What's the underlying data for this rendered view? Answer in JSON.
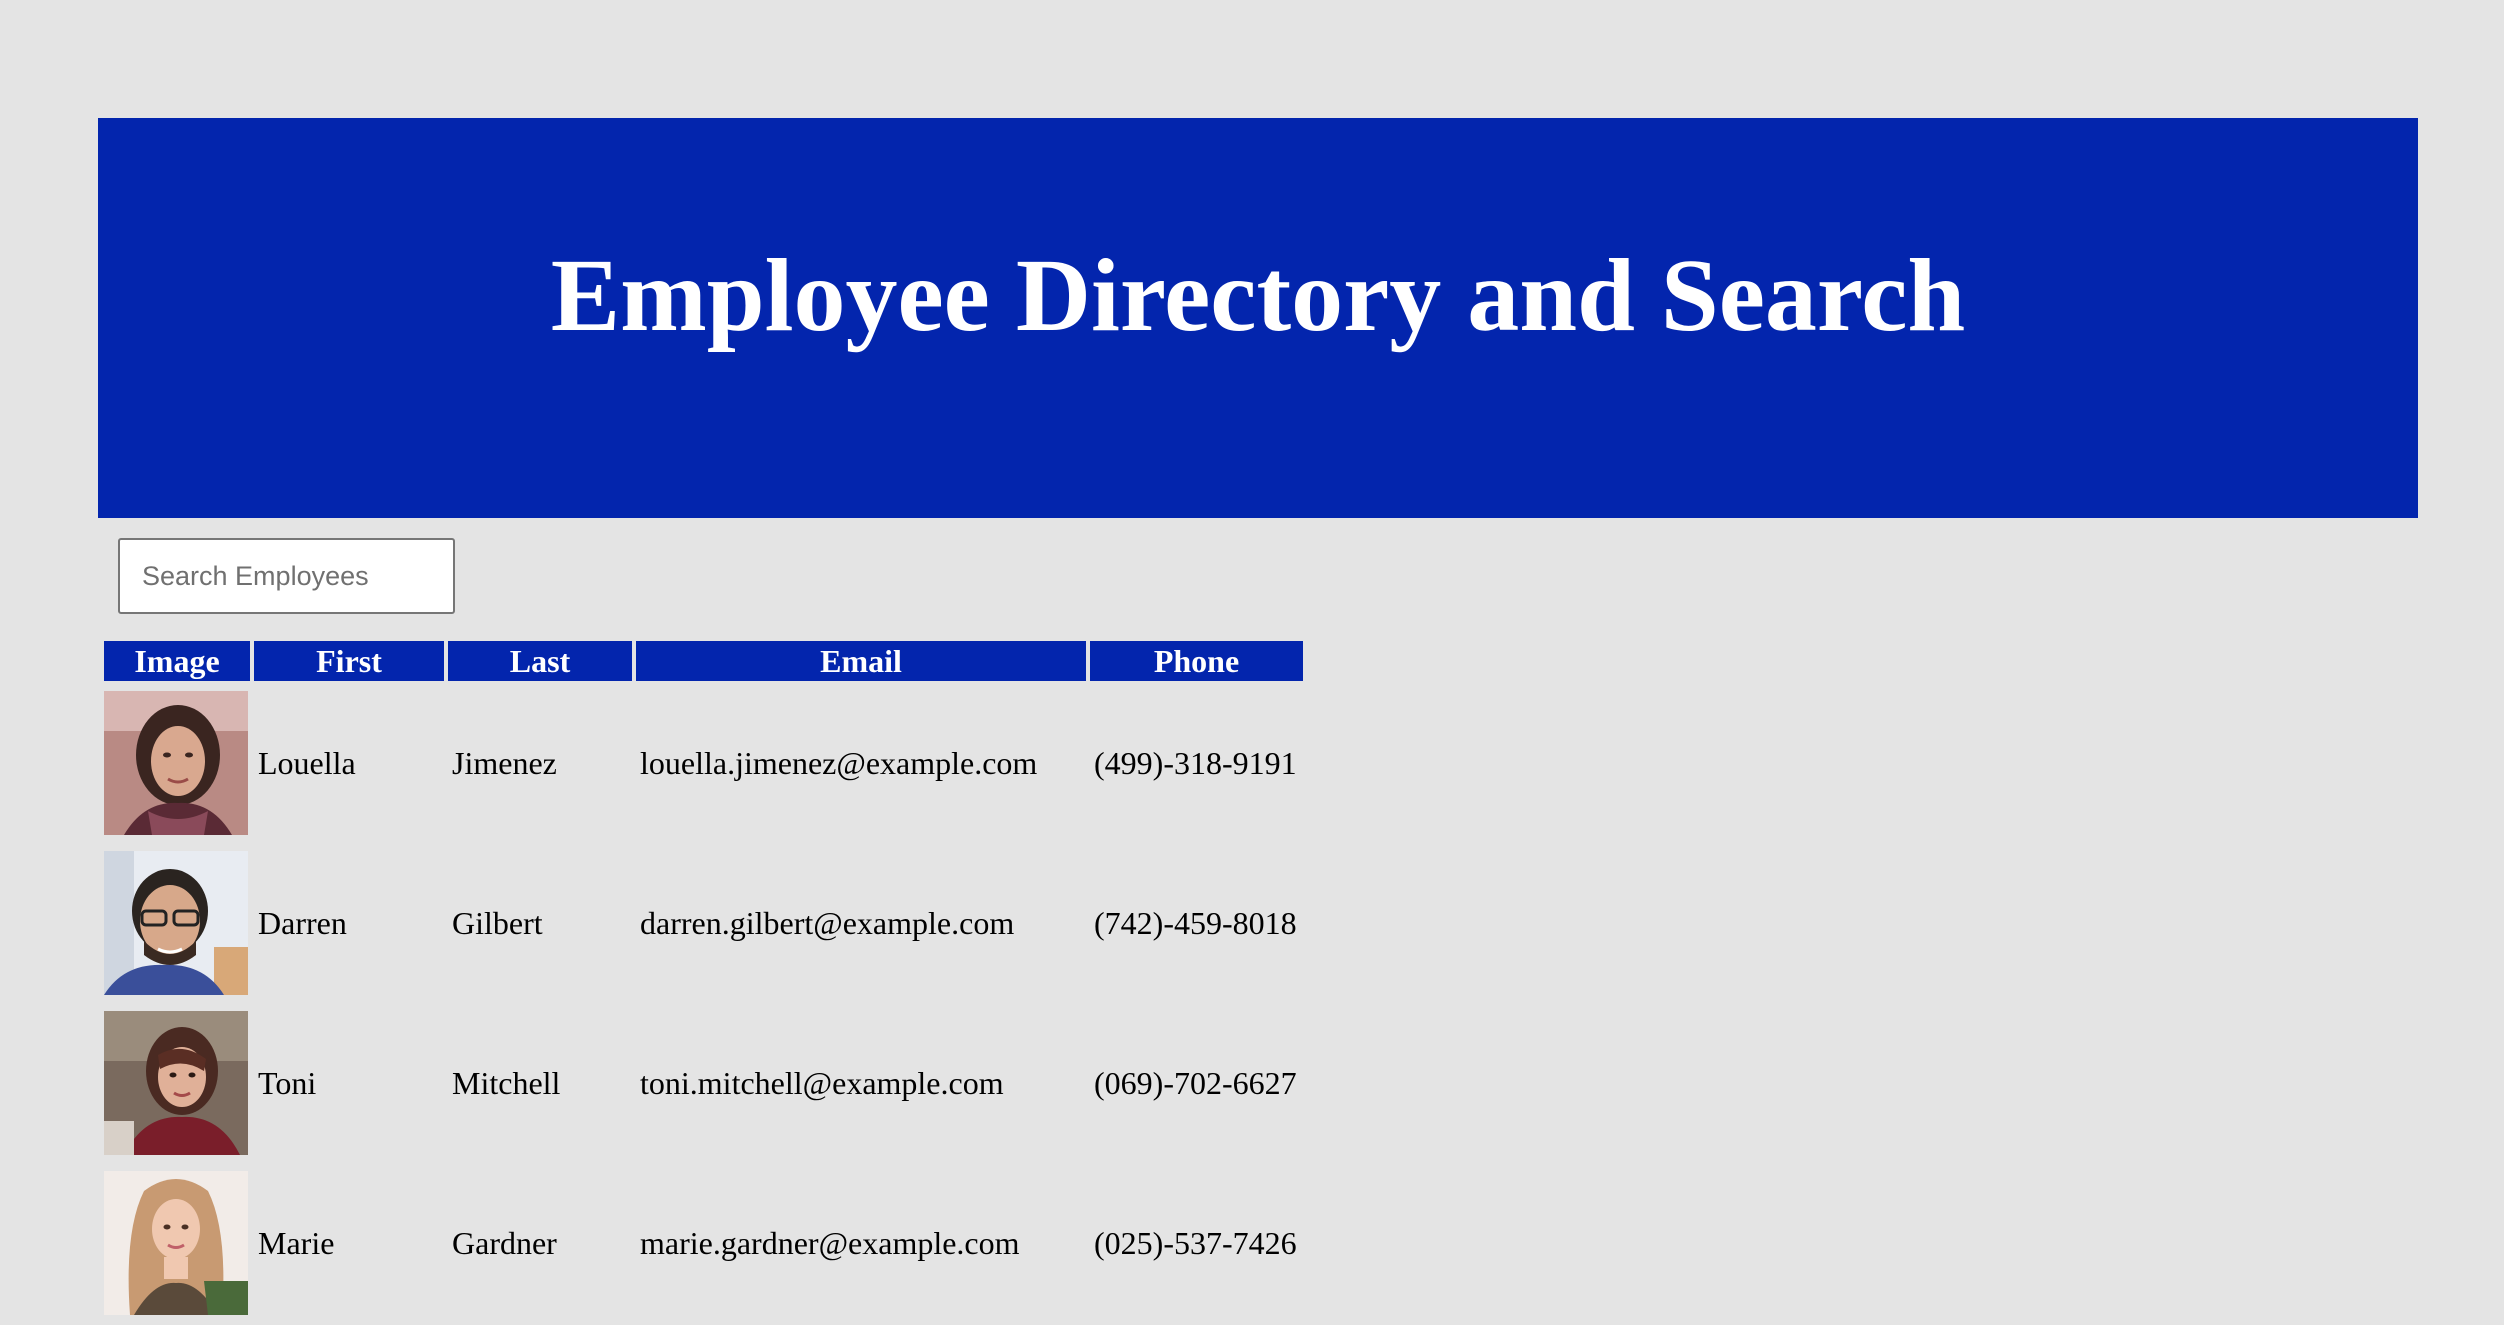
{
  "header": {
    "title": "Employee Directory and Search"
  },
  "search": {
    "placeholder": "Search Employees",
    "value": ""
  },
  "table": {
    "columns": [
      "Image",
      "First",
      "Last",
      "Email",
      "Phone"
    ],
    "rows": [
      {
        "first": "Louella",
        "last": "Jimenez",
        "email": "louella.jimenez@example.com",
        "phone": "(499)-318-9191",
        "avatar": "photo-woman-dark-hair"
      },
      {
        "first": "Darren",
        "last": "Gilbert",
        "email": "darren.gilbert@example.com",
        "phone": "(742)-459-8018",
        "avatar": "photo-man-glasses"
      },
      {
        "first": "Toni",
        "last": "Mitchell",
        "email": "toni.mitchell@example.com",
        "phone": "(069)-702-6627",
        "avatar": "photo-woman-auburn-hair"
      },
      {
        "first": "Marie",
        "last": "Gardner",
        "email": "marie.gardner@example.com",
        "phone": "(025)-537-7426",
        "avatar": "photo-woman-blonde-hair"
      }
    ]
  },
  "colors": {
    "accent": "#0325ad",
    "background": "#e4e4e4",
    "header_text": "#ffffff"
  }
}
